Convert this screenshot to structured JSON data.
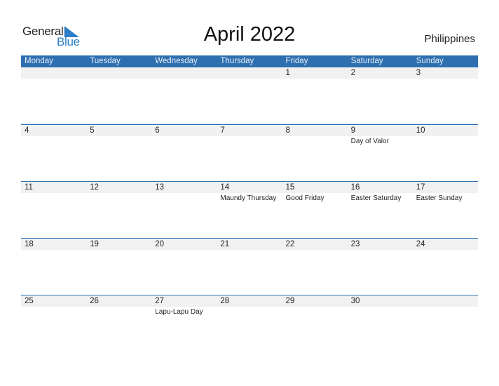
{
  "logo": {
    "line1": "General",
    "line2": "Blue"
  },
  "title": "April 2022",
  "country": "Philippines",
  "colors": {
    "accent": "#2e6fb0",
    "logo_blue": "#2a7fc8",
    "date_strip": "#f1f1f1"
  },
  "weekdays": [
    "Monday",
    "Tuesday",
    "Wednesday",
    "Thursday",
    "Friday",
    "Saturday",
    "Sunday"
  ],
  "weeks": [
    [
      {
        "day": "",
        "holiday": ""
      },
      {
        "day": "",
        "holiday": ""
      },
      {
        "day": "",
        "holiday": ""
      },
      {
        "day": "",
        "holiday": ""
      },
      {
        "day": "1",
        "holiday": ""
      },
      {
        "day": "2",
        "holiday": ""
      },
      {
        "day": "3",
        "holiday": ""
      }
    ],
    [
      {
        "day": "4",
        "holiday": ""
      },
      {
        "day": "5",
        "holiday": ""
      },
      {
        "day": "6",
        "holiday": ""
      },
      {
        "day": "7",
        "holiday": ""
      },
      {
        "day": "8",
        "holiday": ""
      },
      {
        "day": "9",
        "holiday": "Day of Valor"
      },
      {
        "day": "10",
        "holiday": ""
      }
    ],
    [
      {
        "day": "11",
        "holiday": ""
      },
      {
        "day": "12",
        "holiday": ""
      },
      {
        "day": "13",
        "holiday": ""
      },
      {
        "day": "14",
        "holiday": "Maundy Thursday"
      },
      {
        "day": "15",
        "holiday": "Good Friday"
      },
      {
        "day": "16",
        "holiday": "Easter Saturday"
      },
      {
        "day": "17",
        "holiday": "Easter Sunday"
      }
    ],
    [
      {
        "day": "18",
        "holiday": ""
      },
      {
        "day": "19",
        "holiday": ""
      },
      {
        "day": "20",
        "holiday": ""
      },
      {
        "day": "21",
        "holiday": ""
      },
      {
        "day": "22",
        "holiday": ""
      },
      {
        "day": "23",
        "holiday": ""
      },
      {
        "day": "24",
        "holiday": ""
      }
    ],
    [
      {
        "day": "25",
        "holiday": ""
      },
      {
        "day": "26",
        "holiday": ""
      },
      {
        "day": "27",
        "holiday": "Lapu-Lapu Day"
      },
      {
        "day": "28",
        "holiday": ""
      },
      {
        "day": "29",
        "holiday": ""
      },
      {
        "day": "30",
        "holiday": ""
      },
      {
        "day": "",
        "holiday": ""
      }
    ]
  ]
}
